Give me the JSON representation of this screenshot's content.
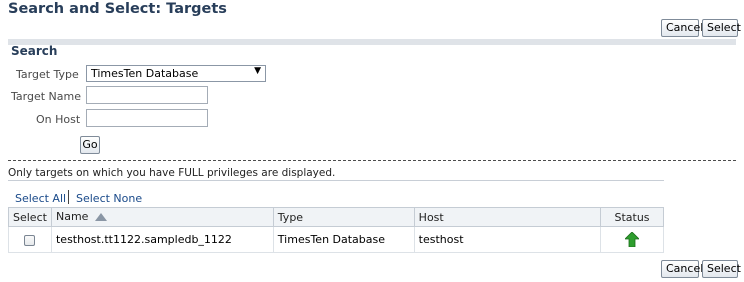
{
  "page": {
    "title": "Search and Select: Targets"
  },
  "buttons": {
    "cancel": "Cancel",
    "select": "Select",
    "go": "Go"
  },
  "search": {
    "heading": "Search",
    "target_type_label": "Target Type",
    "target_type_value": "TimesTen Database",
    "target_name_label": "Target Name",
    "target_name_value": "",
    "on_host_label": "On Host",
    "on_host_value": ""
  },
  "info_text": "Only targets on which you have FULL privileges are displayed.",
  "selection": {
    "select_all": "Select All",
    "select_none": "Select None"
  },
  "table": {
    "headers": {
      "select": "Select",
      "name": "Name",
      "type": "Type",
      "host": "Host",
      "status": "Status"
    },
    "sort": {
      "column": "Name",
      "direction": "ascending"
    },
    "rows": [
      {
        "name": "testhost.tt1122.sampledb_1122",
        "type": "TimesTen Database",
        "host": "testhost",
        "status": "up",
        "selected": false
      }
    ]
  },
  "colors": {
    "title": "#283e5a",
    "link": "#1a4a8a",
    "status_up": "#2e9e2e",
    "band": "#dfe3e8"
  },
  "icons": {
    "sort": "sort-ascending-icon",
    "status": "status-up-arrow-icon",
    "dropdown": "dropdown-arrow-icon"
  }
}
